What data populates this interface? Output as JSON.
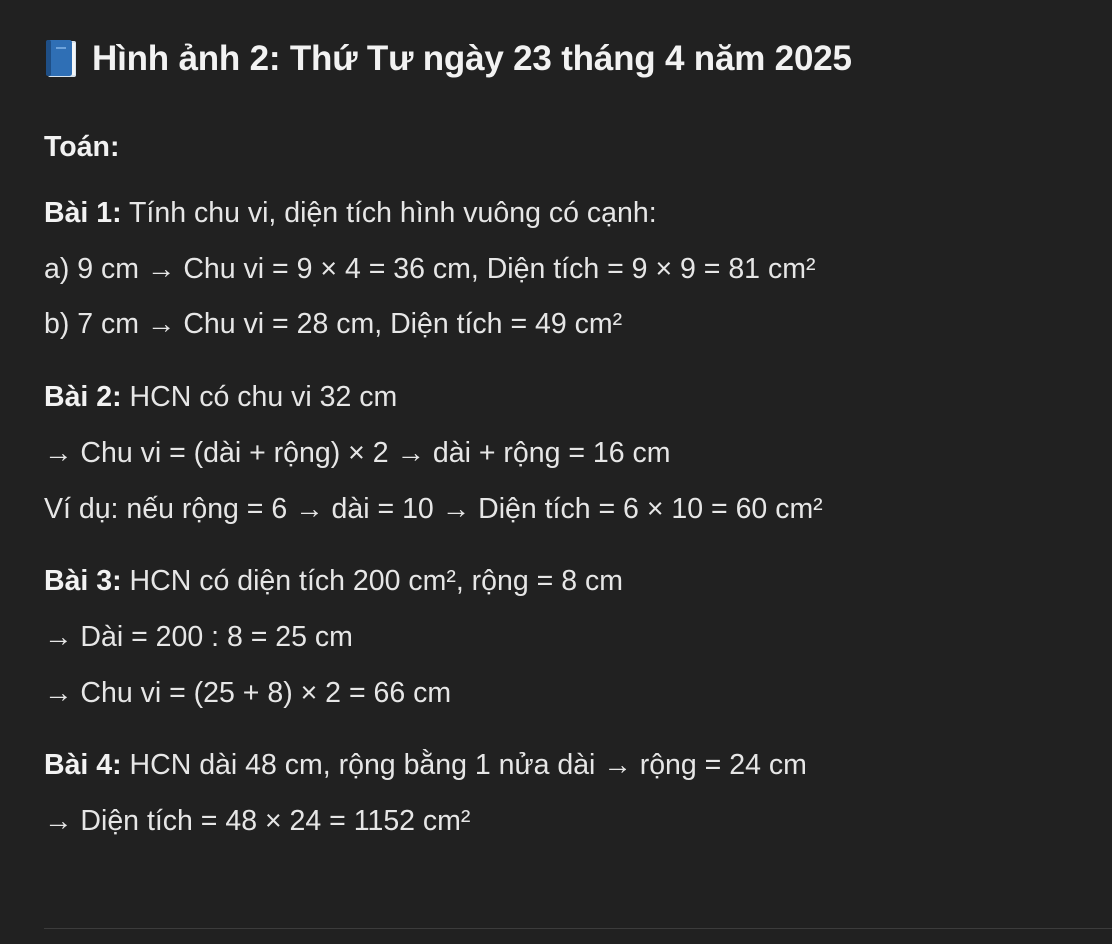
{
  "title": {
    "icon": "blue-book-icon",
    "text": "Hình ảnh 2: Thứ Tư ngày 23 tháng 4 năm 2025"
  },
  "section_heading": "Toán:",
  "exercises": [
    {
      "label": "Bài 1:",
      "heading": " Tính chu vi, diện tích hình vuông có cạnh:",
      "lines": [
        "a) 9 cm → Chu vi = 9 × 4 = 36 cm, Diện tích = 9 × 9 = 81 cm²",
        "b) 7 cm → Chu vi = 28 cm, Diện tích = 49 cm²"
      ]
    },
    {
      "label": "Bài 2:",
      "heading": " HCN có chu vi 32 cm",
      "lines": [
        "→ Chu vi = (dài + rộng) × 2 → dài + rộng = 16 cm",
        "Ví dụ: nếu rộng = 6 → dài = 10 → Diện tích = 6 × 10 = 60 cm²"
      ]
    },
    {
      "label": "Bài 3:",
      "heading": " HCN có diện tích 200 cm², rộng = 8 cm",
      "lines": [
        "→ Dài = 200 : 8 = 25 cm",
        "→ Chu vi = (25 + 8) × 2 = 66 cm"
      ]
    },
    {
      "label": "Bài 4:",
      "heading": " HCN dài 48 cm, rộng bằng 1 nửa dài → rộng = 24 cm",
      "lines": [
        "→ Diện tích = 48 × 24 = 1152 cm²"
      ]
    }
  ]
}
